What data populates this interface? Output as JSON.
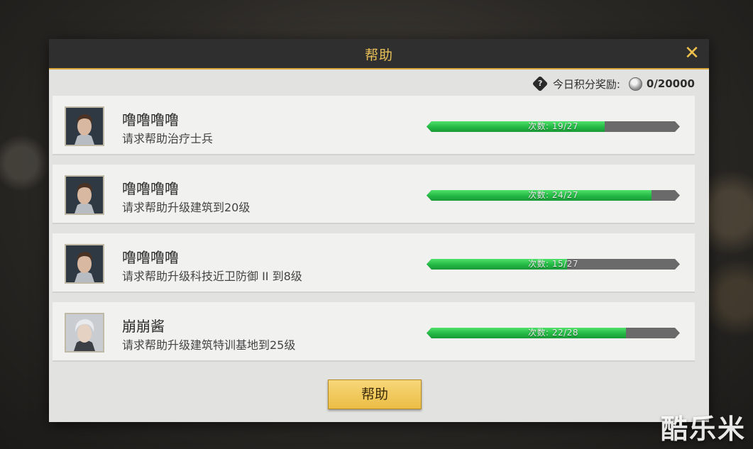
{
  "dialog": {
    "title": "帮助",
    "close_icon": "close-icon",
    "reward_label": "今日积分奖励:",
    "reward_value": "0/20000",
    "help_button_label": "帮助"
  },
  "requests": [
    {
      "name": "噜噜噜噜",
      "description": "请求帮助治疗士兵",
      "count_label": "次数: 19/27",
      "current": 19,
      "total": 27
    },
    {
      "name": "噜噜噜噜",
      "description": "请求帮助升级建筑到20级",
      "count_label": "次数: 24/27",
      "current": 24,
      "total": 27
    },
    {
      "name": "噜噜噜噜",
      "description": "请求帮助升级科技近卫防御 II 到8级",
      "count_label": "次数: 15/27",
      "current": 15,
      "total": 27
    },
    {
      "name": "崩崩酱",
      "description": "请求帮助升级建筑特训基地到25级",
      "count_label": "次数: 22/28",
      "current": 22,
      "total": 28
    }
  ],
  "watermark": "酷乐米",
  "colors": {
    "accent": "#e9c057",
    "progress": "#23b845",
    "button": "#ebbd45"
  }
}
